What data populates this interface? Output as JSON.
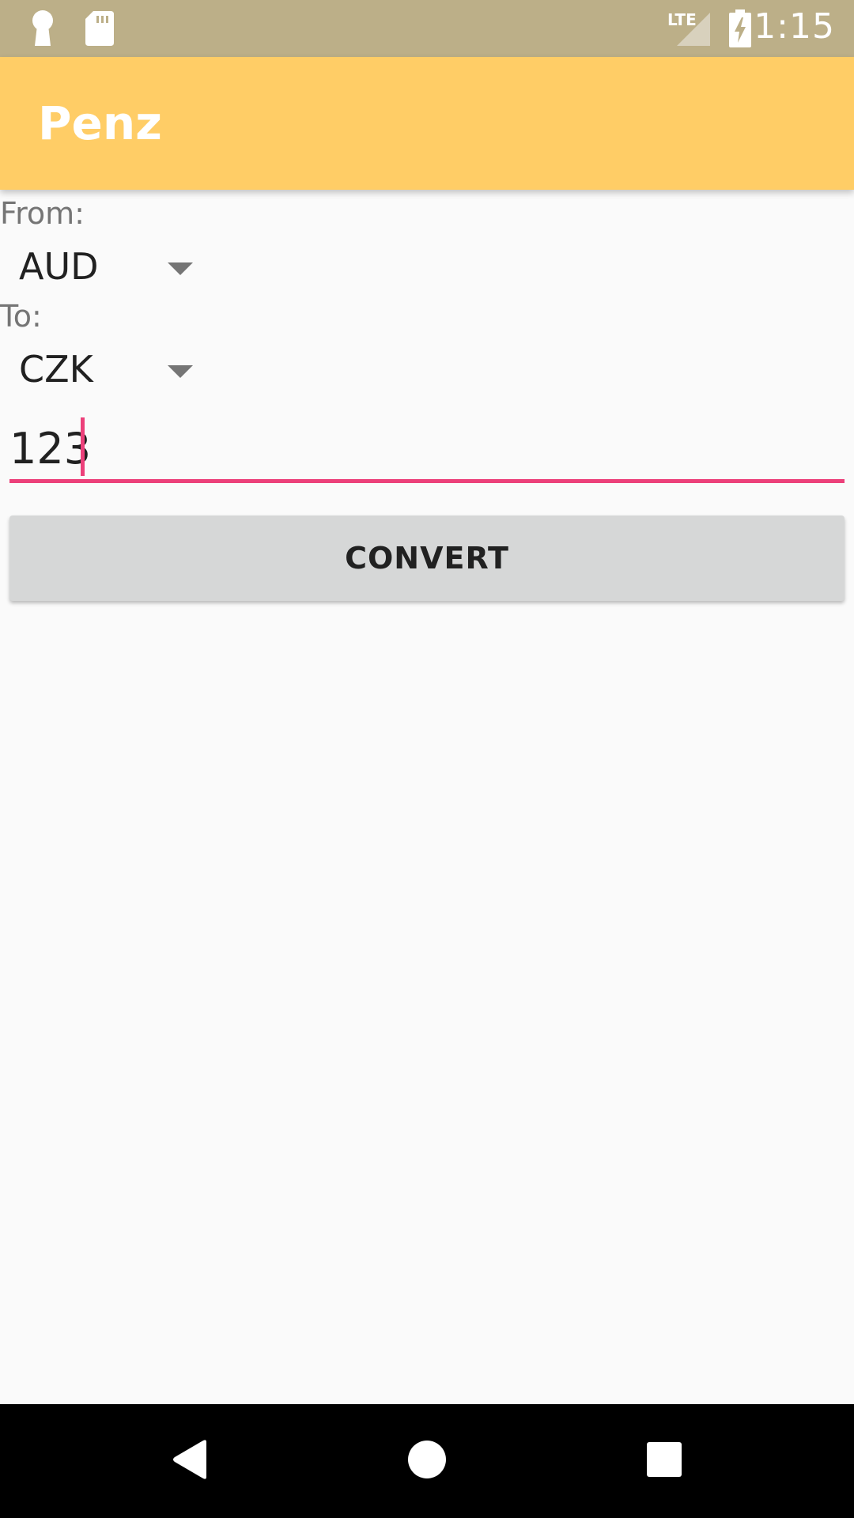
{
  "status_bar": {
    "time": "1:15",
    "network_label": "LTE",
    "icons": [
      "keyhole-icon",
      "sd-card-icon",
      "signal-icon",
      "battery-charging-icon"
    ]
  },
  "app_bar": {
    "title": "Penz",
    "color": "#ffcd66"
  },
  "form": {
    "from_label": "From:",
    "from_value": "AUD",
    "to_label": "To:",
    "to_value": "CZK",
    "amount_value": "123",
    "accent_color": "#ec407a"
  },
  "actions": {
    "convert_label": "CONVERT"
  },
  "nav_bar": {
    "icons": [
      "back-icon",
      "home-icon",
      "recents-icon"
    ]
  }
}
